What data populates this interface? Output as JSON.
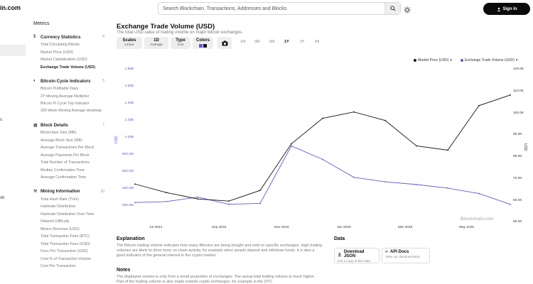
{
  "header": {
    "logo": "in.com",
    "search_placeholder": "Search Blockchain, Transactions, Addresses and Blocks",
    "sign_in": "Sign In"
  },
  "stub_nav": {
    "s_label": "s",
    "sh_label": "sh"
  },
  "sidebar": {
    "title": "Metrics",
    "sections": [
      {
        "label": "Currency Statistics",
        "count": "6",
        "icon": "dollar-icon",
        "items": [
          "Total Circulating Bitcoin",
          "Market Price (USD)",
          "Market Capitalization (USD)",
          "Exchange Trade Volume (USD)"
        ]
      },
      {
        "label": "Bitcoin Cycle Indicators",
        "count": "5",
        "icon": "cycle-icon",
        "items": [
          "Bitcoin Profitable Days",
          "2Y Moving Average Multiplier",
          "Bitcoin Pi Cycle Top Indicator",
          "200 Week Moving Average Heatmap"
        ]
      },
      {
        "label": "Block Details",
        "count": "7",
        "icon": "blocks-icon",
        "items": [
          "Blockchain Size (MB)",
          "Average Block Size (MB)",
          "Average Transactions Per Block",
          "Average Payments Per Block",
          "Total Number of Transactions",
          "Median Confirmation Time",
          "Average Confirmation Time"
        ]
      },
      {
        "label": "Mining Information",
        "count": "10",
        "icon": "mining-icon",
        "items": [
          "Total Hash Rate (TH/s)",
          "Hashrate Distribution",
          "Hashrate Distribution Over Time",
          "Network Difficulty",
          "Miners Revenue (USD)",
          "Total Transaction Fees (BTC)",
          "Total Transaction Fees (USD)",
          "Fees Per Transaction (USD)",
          "Cost % of Transaction Volume",
          "Cost Per Transaction"
        ]
      }
    ]
  },
  "main": {
    "title": "Exchange Trade Volume (USD)",
    "subtitle": "The total USD value of trading volume on major bitcoin exchanges.",
    "controls": [
      {
        "title": "Scales",
        "value": "Linear"
      },
      {
        "title": "1D",
        "value": "Average"
      },
      {
        "title": "Type",
        "value": "Line"
      },
      {
        "title": "Colors",
        "value": ""
      }
    ],
    "ranges": [
      "1M",
      "3M",
      "6M",
      "1Y",
      "3Y",
      "All"
    ],
    "active_range": "1Y",
    "colors": {
      "price": "#111111",
      "volume": "#5b5bd6"
    }
  },
  "chart_data": {
    "type": "line",
    "x": [
      "2024-06",
      "2024-07",
      "2024-08",
      "2024-09",
      "2024-10",
      "2024-11",
      "2024-12",
      "2025-01",
      "2025-02",
      "2025-03",
      "2025-04",
      "2025-05",
      "2025-06"
    ],
    "series": [
      {
        "name": "Market Price (USD)",
        "axis": "right",
        "values": [
          66000,
          62000,
          59000,
          58000,
          63000,
          85000,
          97000,
          100000,
          96000,
          84000,
          82000,
          103000,
          108000
        ]
      },
      {
        "name": "Exchange Trade Volume (USD)",
        "axis": "left",
        "values": [
          320000000,
          330000000,
          380000000,
          300000000,
          310000000,
          950000000,
          800000000,
          600000000,
          550000000,
          520000000,
          480000000,
          420000000,
          300000000
        ]
      }
    ],
    "y_left_ticks": [
      "200.0M",
      "400.0M",
      "600.0M",
      "800.0M",
      "1.00B",
      "1.20B",
      "1.40B",
      "1.60B",
      "1.80B"
    ],
    "y_right_ticks": [
      "50.0K",
      "60.0K",
      "70.0K",
      "80.0K",
      "90.0K",
      "100.0K",
      "110.0K",
      "120.0K"
    ],
    "x_ticks": [
      "Jul 2024",
      "Sep 2024",
      "Nov 2024",
      "Jan 2025",
      "Mar 2025",
      "May 2025"
    ],
    "ylabel_left": "USD",
    "ylabel_right": "USD",
    "ylim_left": [
      100000000,
      1800000000
    ],
    "ylim_right": [
      48000,
      120000
    ],
    "legend": [
      "Market Price (USD)",
      "Exchange Trade Volume (USD)"
    ],
    "legend_placement": "top-right",
    "grid": false,
    "watermark": "Blockchain.com"
  },
  "explanation": {
    "title": "Explanation",
    "text": "The Bitcoin trading volume indicates how many Bitcoins are being bought and sold on specific exchanges. High trading volumes are likely to drive more on-chain activity, for example when people deposit and withdraw funds. It is also a good indicator of the general interest in the crypto market."
  },
  "notes": {
    "title": "Notes",
    "text": "The displayed volume is only from a small proportion of exchanges. The actual total trading volume is much higher. Part of the trading volume is also made outside crypto exchanges, for example in the OTC"
  },
  "data_section": {
    "title": "Data",
    "download_label": "Download JSON",
    "download_sub": "Get a copy of this data",
    "api_label": "API Docs",
    "api_sub": "View our documentation"
  }
}
